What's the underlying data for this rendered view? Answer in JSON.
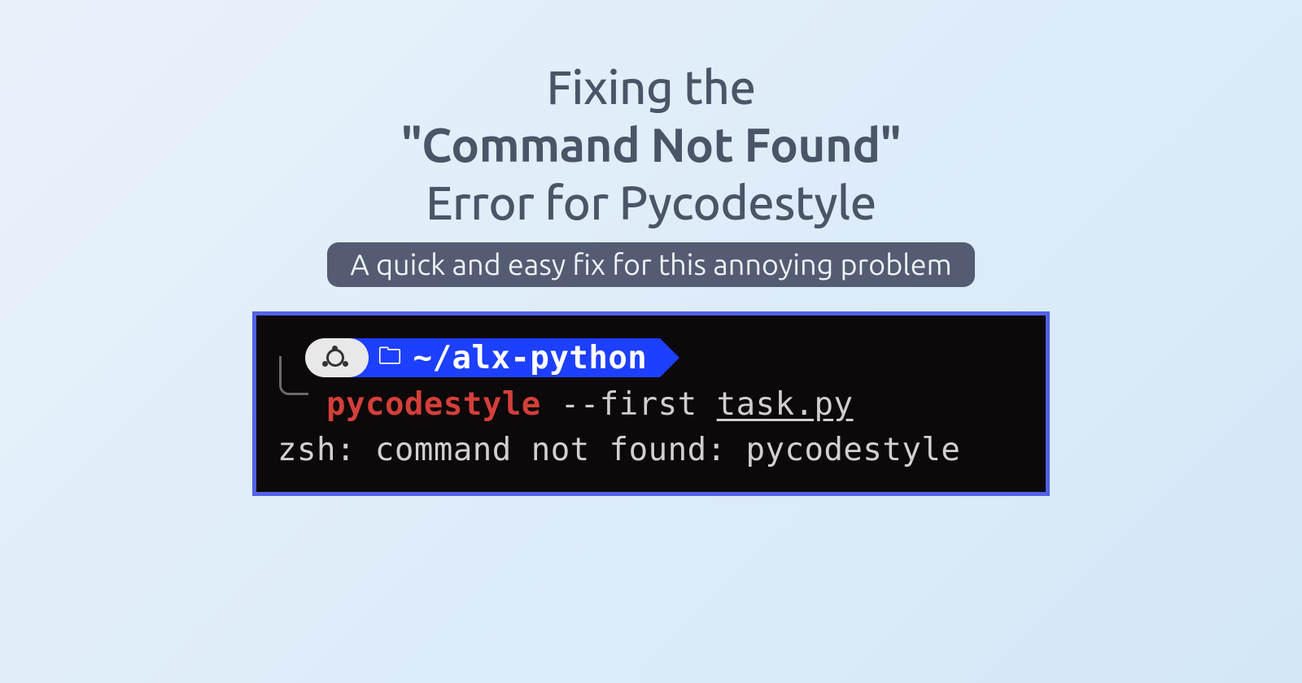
{
  "heading": {
    "line1": "Fixing the",
    "line2": "\"Command Not Found\"",
    "line3": "Error for Pycodestyle"
  },
  "subtitle": "A quick and easy fix for this annoying problem",
  "terminal": {
    "path": "~/alx-python",
    "command_name": "pycodestyle",
    "command_args": "--first",
    "command_file": "task.py",
    "error": "zsh: command not found: pycodestyle"
  }
}
